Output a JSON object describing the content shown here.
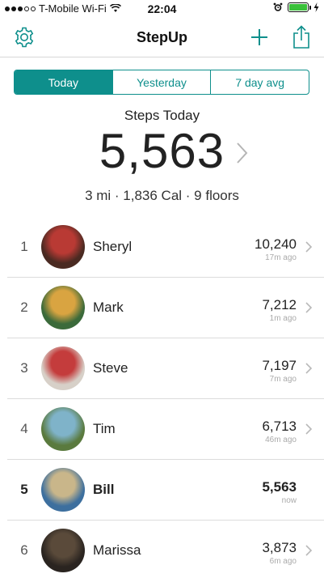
{
  "status_bar": {
    "carrier": "T-Mobile Wi-Fi",
    "time": "22:04"
  },
  "nav": {
    "title": "StepUp",
    "icons": {
      "left": "gear-icon",
      "add": "plus-icon",
      "share": "share-icon"
    },
    "accent_color": "#0e8f8c"
  },
  "segments": [
    {
      "label": "Today",
      "active": true
    },
    {
      "label": "Yesterday",
      "active": false
    },
    {
      "label": "7 day avg",
      "active": false
    }
  ],
  "summary": {
    "label": "Steps Today",
    "value": "5,563",
    "stats": "3 mi · 1,836 Cal · 9 floors"
  },
  "leaderboard": [
    {
      "rank": "1",
      "name": "Sheryl",
      "steps": "10,240",
      "ago": "17m ago",
      "me": false,
      "avatar_colors": [
        "#b93a34",
        "#4a2a22"
      ]
    },
    {
      "rank": "2",
      "name": "Mark",
      "steps": "7,212",
      "ago": "1m ago",
      "me": false,
      "avatar_colors": [
        "#d9a441",
        "#3b6a3a"
      ]
    },
    {
      "rank": "3",
      "name": "Steve",
      "steps": "7,197",
      "ago": "7m ago",
      "me": false,
      "avatar_colors": [
        "#c43c3c",
        "#d7d0c8"
      ]
    },
    {
      "rank": "4",
      "name": "Tim",
      "steps": "6,713",
      "ago": "46m ago",
      "me": false,
      "avatar_colors": [
        "#7fb3c9",
        "#5a7a3e"
      ]
    },
    {
      "rank": "5",
      "name": "Bill",
      "steps": "5,563",
      "ago": "now",
      "me": true,
      "avatar_colors": [
        "#c9b68a",
        "#3d6f9e"
      ]
    },
    {
      "rank": "6",
      "name": "Marissa",
      "steps": "3,873",
      "ago": "6m ago",
      "me": false,
      "avatar_colors": [
        "#5a4a3a",
        "#2a2420"
      ]
    }
  ]
}
